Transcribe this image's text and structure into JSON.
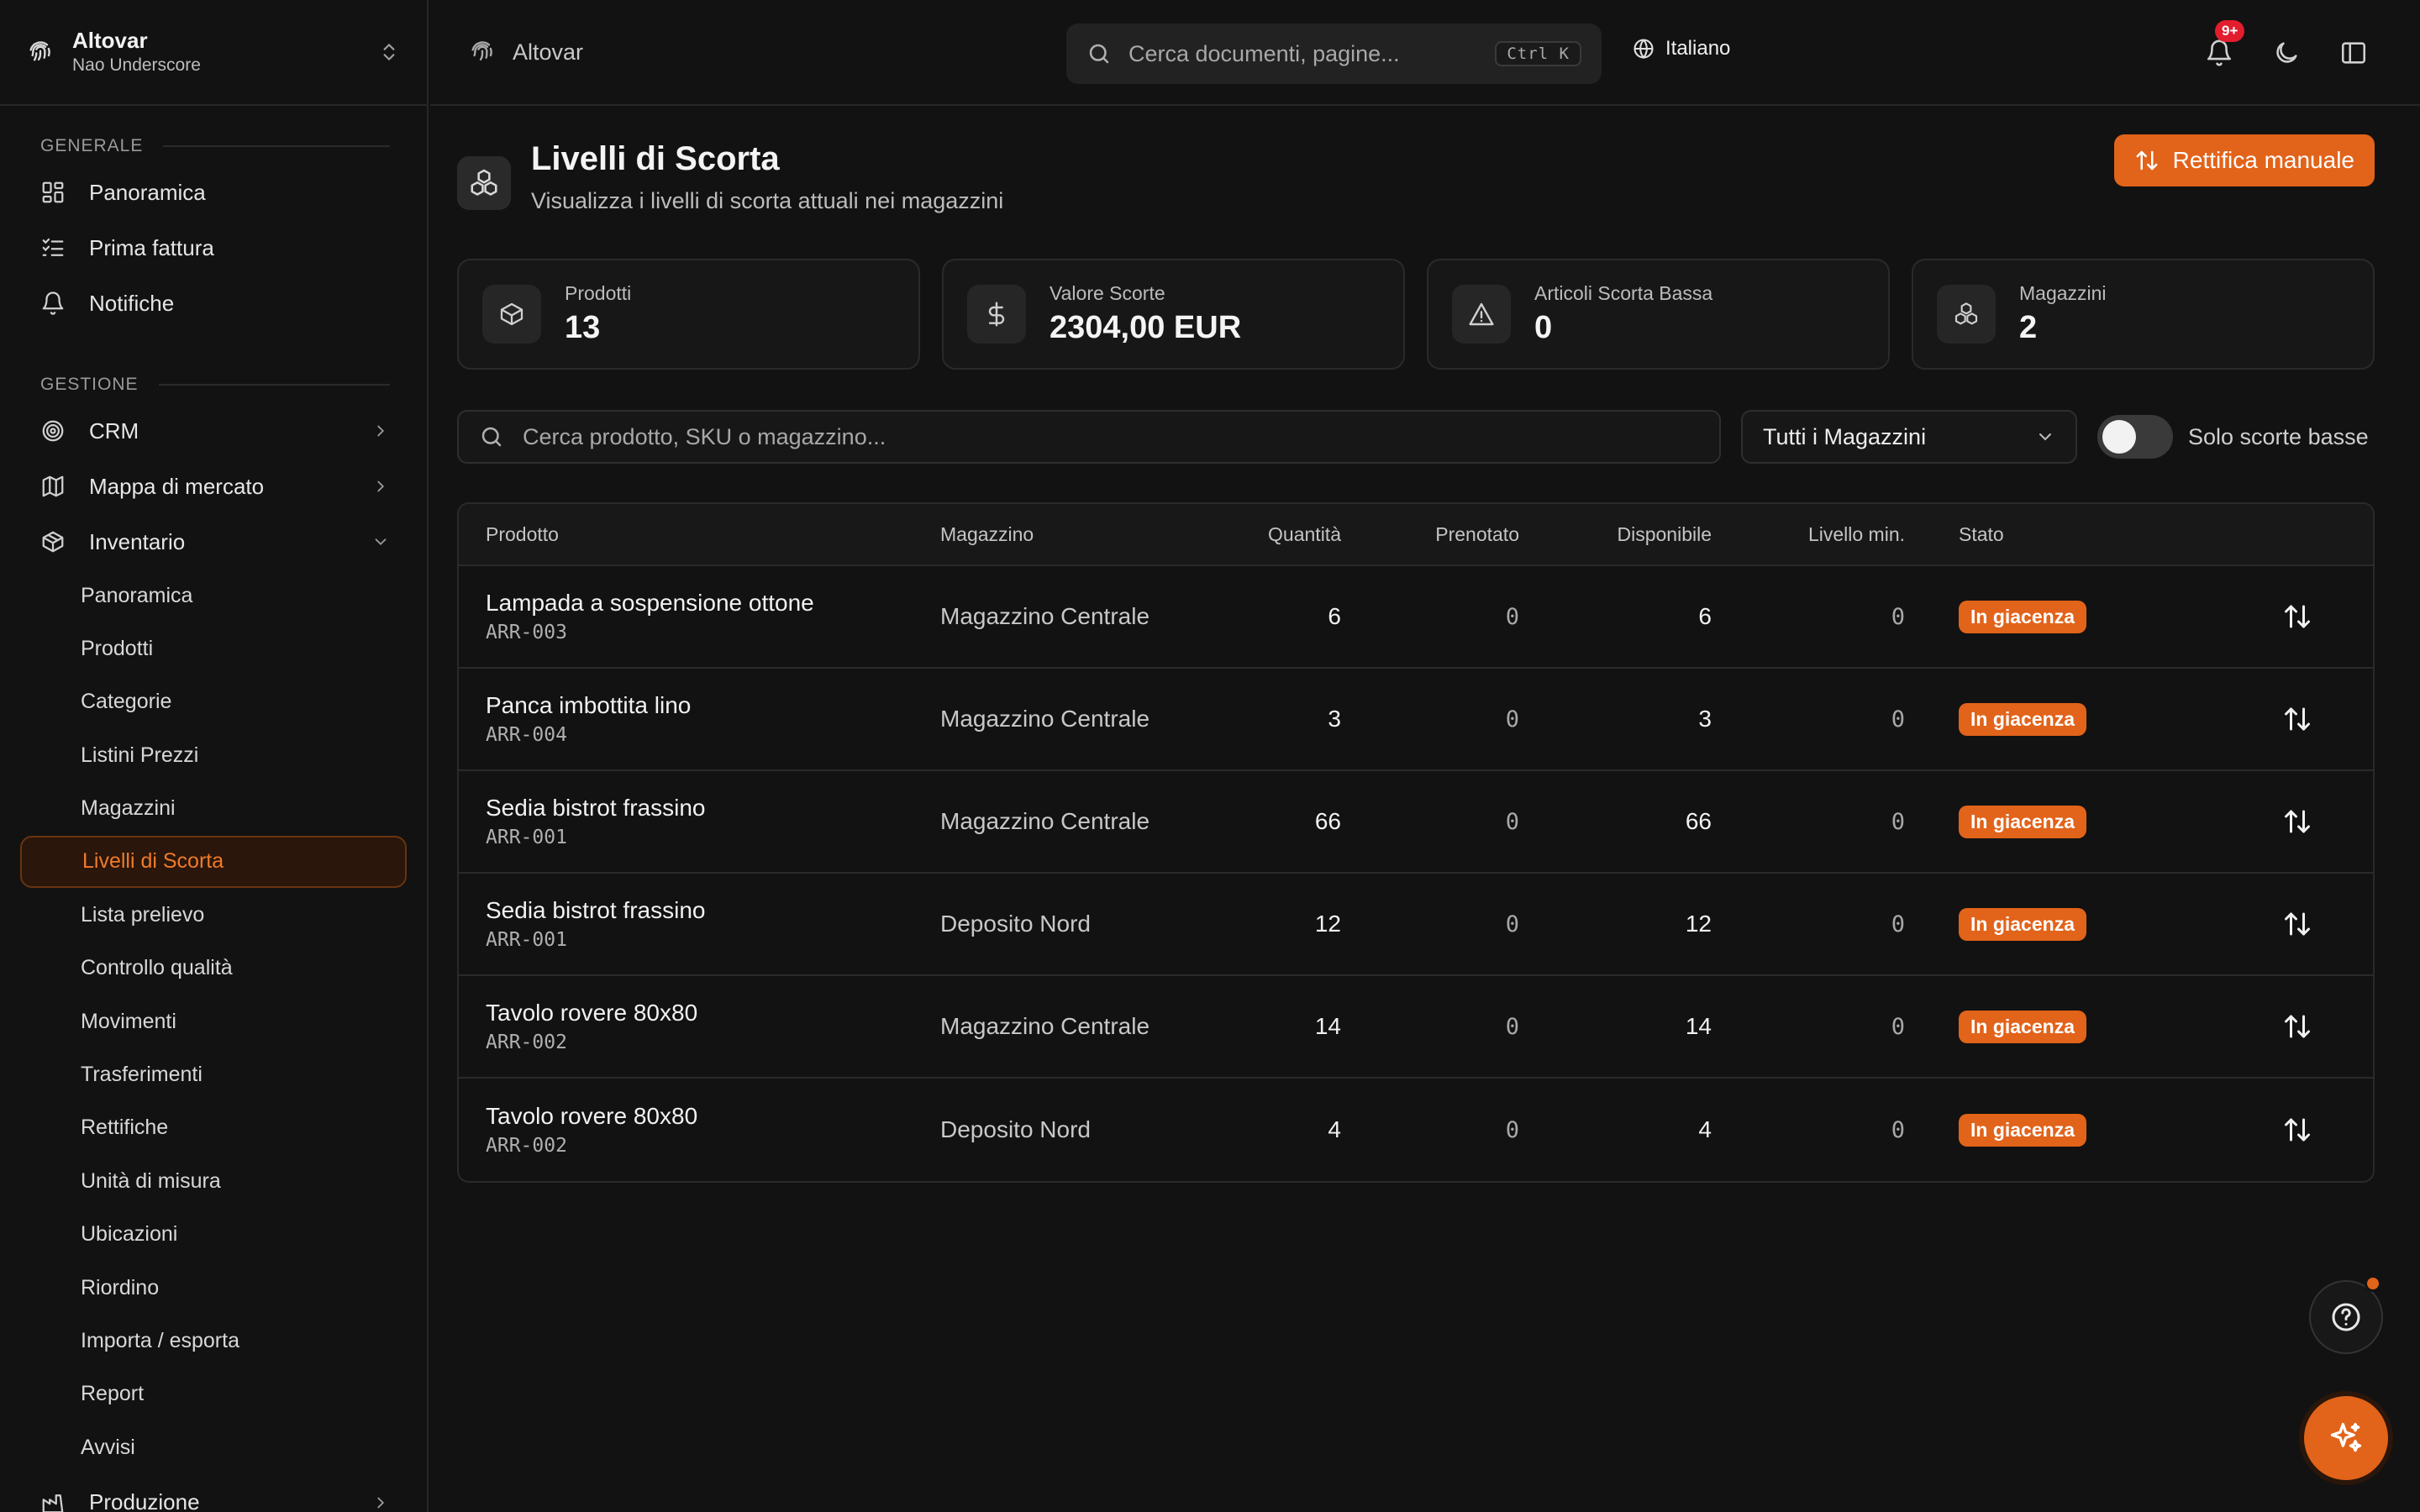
{
  "workspace": {
    "name": "Altovar",
    "user": "Nao Underscore"
  },
  "sidebar": {
    "sections": [
      {
        "title": "GENERALE",
        "items": [
          {
            "label": "Panoramica",
            "icon": "dashboard-icon"
          },
          {
            "label": "Prima fattura",
            "icon": "checklist-icon"
          },
          {
            "label": "Notifiche",
            "icon": "bell-icon"
          }
        ]
      },
      {
        "title": "GESTIONE",
        "items": [
          {
            "label": "CRM",
            "icon": "target-icon"
          },
          {
            "label": "Mappa di mercato",
            "icon": "map-icon"
          },
          {
            "label": "Inventario",
            "icon": "box-icon"
          }
        ]
      }
    ],
    "inventory_sub": [
      "Panoramica",
      "Prodotti",
      "Categorie",
      "Listini Prezzi",
      "Magazzini",
      "Livelli di Scorta",
      "Lista prelievo",
      "Controllo qualità",
      "Movimenti",
      "Trasferimenti",
      "Rettifiche",
      "Unità di misura",
      "Ubicazioni",
      "Riordino",
      "Importa / esporta",
      "Report",
      "Avvisi"
    ],
    "active_sub": "Livelli di Scorta",
    "after": {
      "label": "Produzione",
      "icon": "factory-icon"
    }
  },
  "topbar": {
    "breadcrumb": "Altovar",
    "search_placeholder": "Cerca documenti, pagine...",
    "shortcut": "Ctrl K",
    "language": "Italiano",
    "notifications_badge": "9+"
  },
  "page": {
    "title": "Livelli di Scorta",
    "subtitle": "Visualizza i livelli di scorta attuali nei magazzini",
    "primary_action": "Rettifica manuale"
  },
  "stats": [
    {
      "label": "Prodotti",
      "value": "13",
      "icon": "package-icon"
    },
    {
      "label": "Valore Scorte",
      "value": "2304,00 EUR",
      "icon": "dollar-icon"
    },
    {
      "label": "Articoli Scorta Bassa",
      "value": "0",
      "icon": "warning-icon"
    },
    {
      "label": "Magazzini",
      "value": "2",
      "icon": "boxes-icon"
    }
  ],
  "filters": {
    "search_placeholder": "Cerca prodotto, SKU o magazzino...",
    "warehouse_select": "Tutti i Magazzini",
    "low_stock_toggle_label": "Solo scorte basse",
    "low_stock_toggle_on": false
  },
  "table": {
    "columns": [
      "Prodotto",
      "Magazzino",
      "Quantità",
      "Prenotato",
      "Disponibile",
      "Livello min.",
      "Stato"
    ],
    "rows": [
      {
        "product": "Lampada a sospensione ottone",
        "sku": "ARR-003",
        "warehouse": "Magazzino Centrale",
        "qty": "6",
        "reserved": "0",
        "available": "6",
        "min": "0",
        "status": "In giacenza"
      },
      {
        "product": "Panca imbottita lino",
        "sku": "ARR-004",
        "warehouse": "Magazzino Centrale",
        "qty": "3",
        "reserved": "0",
        "available": "3",
        "min": "0",
        "status": "In giacenza"
      },
      {
        "product": "Sedia bistrot frassino",
        "sku": "ARR-001",
        "warehouse": "Magazzino Centrale",
        "qty": "66",
        "reserved": "0",
        "available": "66",
        "min": "0",
        "status": "In giacenza"
      },
      {
        "product": "Sedia bistrot frassino",
        "sku": "ARR-001",
        "warehouse": "Deposito Nord",
        "qty": "12",
        "reserved": "0",
        "available": "12",
        "min": "0",
        "status": "In giacenza"
      },
      {
        "product": "Tavolo rovere 80x80",
        "sku": "ARR-002",
        "warehouse": "Magazzino Centrale",
        "qty": "14",
        "reserved": "0",
        "available": "14",
        "min": "0",
        "status": "In giacenza"
      },
      {
        "product": "Tavolo rovere 80x80",
        "sku": "ARR-002",
        "warehouse": "Deposito Nord",
        "qty": "4",
        "reserved": "0",
        "available": "4",
        "min": "0",
        "status": "In giacenza"
      }
    ]
  },
  "colors": {
    "accent": "#e2631a",
    "background": "#121212",
    "badge": "#e11d2e"
  }
}
